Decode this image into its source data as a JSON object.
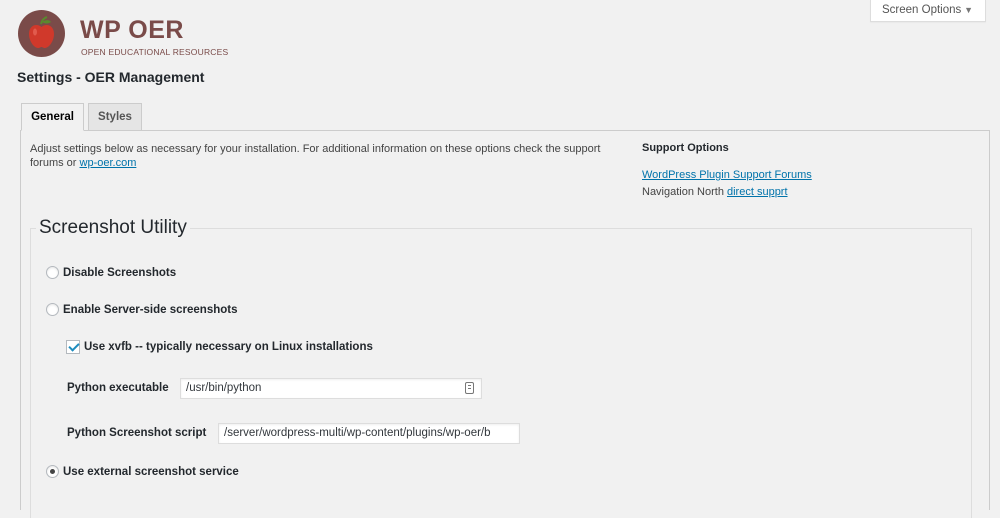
{
  "brand": {
    "title": "WP OER",
    "subtitle": "OPEN EDUCATIONAL RESOURCES",
    "colors": {
      "primary": "#7a4b49",
      "apple": "#d0392b",
      "leaf": "#5a8a2e"
    }
  },
  "screen_options": {
    "label": "Screen Options",
    "icon": "caret-down-icon"
  },
  "page": {
    "title": "Settings - OER Management"
  },
  "tabs": [
    {
      "label": "General",
      "active": true
    },
    {
      "label": "Styles",
      "active": false
    }
  ],
  "intro": {
    "text": "Adjust settings below as necessary for your installation. For additional information on these options check the support forums or ",
    "link": "wp-oer.com"
  },
  "support": {
    "title": "Support Options",
    "forum_link": "WordPress Plugin Support Forums",
    "nav_prefix": "Navigation North ",
    "nav_link": "direct supprt"
  },
  "screenshot_utility": {
    "legend": "Screenshot Utility",
    "options": [
      {
        "label": "Disable Screenshots",
        "checked": false
      },
      {
        "label": "Enable Server-side screenshots",
        "checked": false
      },
      {
        "label": "Use external screenshot service",
        "checked": true
      }
    ],
    "xvfb": {
      "label": "Use xvfb -- typically necessary on Linux installations",
      "checked": true
    },
    "python_executable": {
      "label": "Python executable",
      "value": "/usr/bin/python"
    },
    "python_script": {
      "label": "Python Screenshot script",
      "value": "/server/wordpress-multi/wp-content/plugins/wp-oer/b"
    }
  },
  "colors": {
    "link": "#0073aa",
    "checkmark": "#1e8cbe",
    "background": "#f1f1f1"
  }
}
